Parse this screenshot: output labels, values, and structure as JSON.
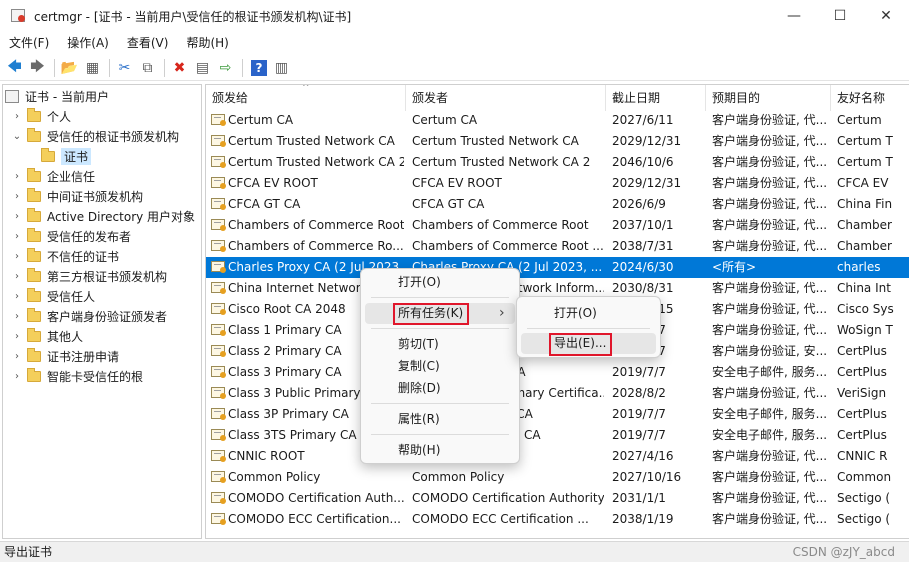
{
  "window": {
    "app": "certmgr",
    "title": "certmgr - [证书 - 当前用户\\受信任的根证书颁发机构\\证书]",
    "min_glyph": "—",
    "max_glyph": "☐",
    "close_glyph": "✕"
  },
  "menu": [
    "文件(F)",
    "操作(A)",
    "查看(V)",
    "帮助(H)"
  ],
  "toolbar": [
    {
      "name": "back-arrow-icon",
      "glyph": "🡄"
    },
    {
      "name": "forward-arrow-icon",
      "glyph": "🡆"
    },
    {
      "sep": true
    },
    {
      "name": "up-folder-icon",
      "glyph": "📂"
    },
    {
      "name": "show-tree-icon",
      "glyph": "▦"
    },
    {
      "sep": true
    },
    {
      "name": "cut-icon",
      "glyph": "✂"
    },
    {
      "name": "copy-icon",
      "glyph": "⧉"
    },
    {
      "sep": true
    },
    {
      "name": "delete-icon",
      "glyph": "✖"
    },
    {
      "name": "properties-icon",
      "glyph": "▤"
    },
    {
      "name": "export-list-icon",
      "glyph": "⇨"
    },
    {
      "sep": true
    },
    {
      "name": "help-icon",
      "glyph": "?"
    },
    {
      "name": "console-view-icon",
      "glyph": "▥"
    }
  ],
  "tree": [
    {
      "label": "证书 - 当前用户",
      "level": 0,
      "chev": "",
      "root": true
    },
    {
      "label": "个人",
      "level": 1,
      "chev": "›"
    },
    {
      "label": "受信任的根证书颁发机构",
      "level": 1,
      "chev": "⌄"
    },
    {
      "label": "证书",
      "level": 2,
      "chev": "",
      "selected": true
    },
    {
      "label": "企业信任",
      "level": 1,
      "chev": "›"
    },
    {
      "label": "中间证书颁发机构",
      "level": 1,
      "chev": "›"
    },
    {
      "label": "Active Directory 用户对象",
      "level": 1,
      "chev": "›"
    },
    {
      "label": "受信任的发布者",
      "level": 1,
      "chev": "›"
    },
    {
      "label": "不信任的证书",
      "level": 1,
      "chev": "›"
    },
    {
      "label": "第三方根证书颁发机构",
      "level": 1,
      "chev": "›"
    },
    {
      "label": "受信任人",
      "level": 1,
      "chev": "›"
    },
    {
      "label": "客户端身份验证颁发者",
      "level": 1,
      "chev": "›"
    },
    {
      "label": "其他人",
      "level": 1,
      "chev": "›"
    },
    {
      "label": "证书注册申请",
      "level": 1,
      "chev": "›"
    },
    {
      "label": "智能卡受信任的根",
      "level": 1,
      "chev": "›"
    }
  ],
  "columns": [
    "颁发给",
    "颁发者",
    "截止日期",
    "预期目的",
    "友好名称"
  ],
  "sort_arrow": "^",
  "rows": [
    [
      "Certum CA",
      "Certum CA",
      "2027/6/11",
      "客户端身份验证, 代...",
      "Certum"
    ],
    [
      "Certum Trusted Network CA",
      "Certum Trusted Network CA",
      "2029/12/31",
      "客户端身份验证, 代...",
      "Certum T"
    ],
    [
      "Certum Trusted Network CA 2",
      "Certum Trusted Network CA 2",
      "2046/10/6",
      "客户端身份验证, 代...",
      "Certum T"
    ],
    [
      "CFCA EV ROOT",
      "CFCA EV ROOT",
      "2029/12/31",
      "客户端身份验证, 代...",
      "CFCA EV"
    ],
    [
      "CFCA GT CA",
      "CFCA GT CA",
      "2026/6/9",
      "客户端身份验证, 代...",
      "China Fin"
    ],
    [
      "Chambers of Commerce Root",
      "Chambers of Commerce Root",
      "2037/10/1",
      "客户端身份验证, 代...",
      "Chamber"
    ],
    [
      "Chambers of Commerce Ro...",
      "Chambers of Commerce Root ...",
      "2038/7/31",
      "客户端身份验证, 代...",
      "Chamber"
    ],
    [
      "Charles Proxy CA (2 Jul 2023...",
      "Charles Proxy CA (2 Jul 2023, ...",
      "2024/6/30",
      "<所有>",
      "charles"
    ],
    [
      "China Internet Network...",
      "China Internet Network Inform...",
      "2030/8/31",
      "客户端身份验证, 代...",
      "China Int"
    ],
    [
      "Cisco Root CA 2048",
      "Cisco Root CA 2048",
      "2029/5/15",
      "客户端身份验证, 代...",
      "Cisco Sys"
    ],
    [
      "Class 1 Primary CA",
      "Class 1 Primary CA",
      "2020/7/7",
      "客户端身份验证, 代...",
      "WoSign T"
    ],
    [
      "Class 2 Primary CA",
      "Class 2 Primary CA",
      "2019/7/7",
      "客户端身份验证, 安...",
      "CertPlus"
    ],
    [
      "Class 3 Primary CA",
      "Class 3 Primary CA",
      "2019/7/7",
      "安全电子邮件, 服务...",
      "CertPlus"
    ],
    [
      "Class 3 Public Primary...",
      "Class 3 Public Primary Certifica...",
      "2028/8/2",
      "客户端身份验证, 代...",
      "VeriSign"
    ],
    [
      "Class 3P Primary CA",
      "Class 3P Primary CA",
      "2019/7/7",
      "安全电子邮件, 服务...",
      "CertPlus"
    ],
    [
      "Class 3TS Primary CA",
      "Class 3TS Primary CA",
      "2019/7/7",
      "安全电子邮件, 服务...",
      "CertPlus"
    ],
    [
      "CNNIC ROOT",
      "CNNIC ROOT",
      "2027/4/16",
      "客户端身份验证, 代...",
      "CNNIC R"
    ],
    [
      "Common Policy",
      "Common Policy",
      "2027/10/16",
      "客户端身份验证, 代...",
      "Common"
    ],
    [
      "COMODO Certification Auth...",
      "COMODO Certification Authority",
      "2031/1/1",
      "客户端身份验证, 代...",
      "Sectigo ("
    ],
    [
      "COMODO ECC Certification...",
      "COMODO ECC Certification ...",
      "2038/1/19",
      "客户端身份验证, 代...",
      "Sectigo ("
    ]
  ],
  "context_menu": {
    "items": [
      "打开(O)",
      "所有任务(K)",
      "剪切(T)",
      "复制(C)",
      "删除(D)",
      "属性(R)",
      "帮助(H)"
    ],
    "submenu_arrow": "›"
  },
  "submenu": {
    "items": [
      "打开(O)",
      "导出(E)..."
    ]
  },
  "status": {
    "text": "导出证书",
    "watermark": "CSDN @zJY_abcd"
  },
  "colors": {
    "selection": "#0078d7",
    "highlight_box": "#e0162b",
    "tree_selection": "#cce8ff"
  }
}
